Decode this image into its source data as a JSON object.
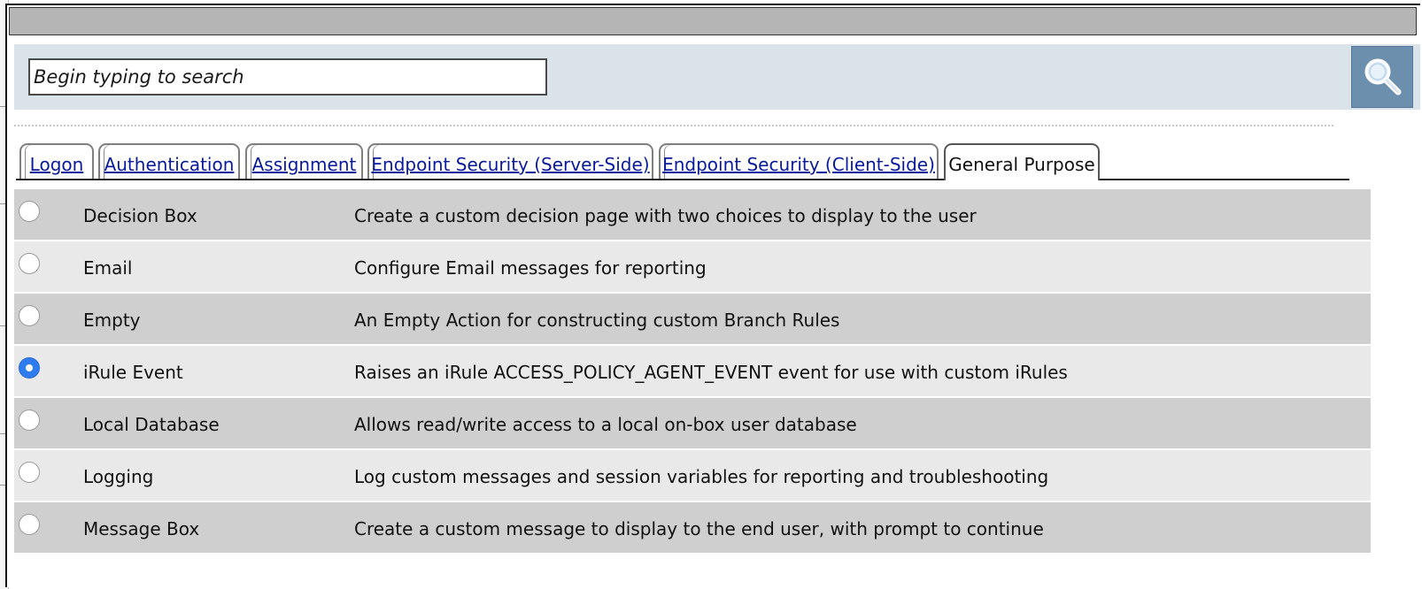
{
  "search": {
    "placeholder": "Begin typing to search",
    "button_icon": "magnifier-icon"
  },
  "tabs": [
    {
      "label": "Logon",
      "active": false
    },
    {
      "label": "Authentication",
      "active": false
    },
    {
      "label": "Assignment",
      "active": false
    },
    {
      "label": "Endpoint Security (Server-Side)",
      "active": false
    },
    {
      "label": "Endpoint Security (Client-Side)",
      "active": false
    },
    {
      "label": "General Purpose",
      "active": true
    }
  ],
  "items": [
    {
      "name": "Decision Box",
      "description": "Create a custom decision page with two choices to display to the user",
      "selected": false
    },
    {
      "name": "Email",
      "description": "Configure Email messages for reporting",
      "selected": false
    },
    {
      "name": "Empty",
      "description": "An Empty Action for constructing custom Branch Rules",
      "selected": false
    },
    {
      "name": "iRule Event",
      "description": "Raises an iRule ACCESS_POLICY_AGENT_EVENT event for use with custom iRules",
      "selected": true
    },
    {
      "name": "Local Database",
      "description": "Allows read/write access to a local on-box user database",
      "selected": false
    },
    {
      "name": "Logging",
      "description": "Log custom messages and session variables for reporting and troubleshooting",
      "selected": false
    },
    {
      "name": "Message Box",
      "description": "Create a custom message to display to the end user, with prompt to continue",
      "selected": false
    }
  ],
  "colors": {
    "link": "#0a1a9c",
    "search_panel": "#dbe3ea",
    "search_button": "#6d8fae",
    "row_dark": "#cfcfcf",
    "row_light": "#e9e9e9",
    "radio_selected": "#2d7cf0"
  }
}
